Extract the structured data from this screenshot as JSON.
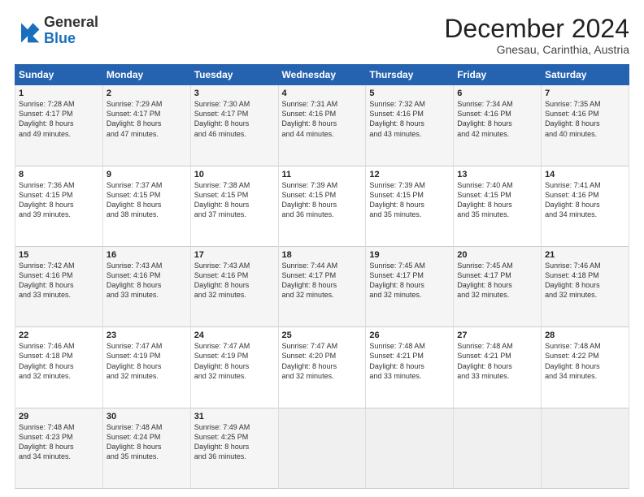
{
  "header": {
    "logo_line1": "General",
    "logo_line2": "Blue",
    "month": "December 2024",
    "location": "Gnesau, Carinthia, Austria"
  },
  "weekdays": [
    "Sunday",
    "Monday",
    "Tuesday",
    "Wednesday",
    "Thursday",
    "Friday",
    "Saturday"
  ],
  "weeks": [
    [
      {
        "day": "1",
        "sunrise": "Sunrise: 7:28 AM",
        "sunset": "Sunset: 4:17 PM",
        "daylight": "Daylight: 8 hours and 49 minutes."
      },
      {
        "day": "2",
        "sunrise": "Sunrise: 7:29 AM",
        "sunset": "Sunset: 4:17 PM",
        "daylight": "Daylight: 8 hours and 47 minutes."
      },
      {
        "day": "3",
        "sunrise": "Sunrise: 7:30 AM",
        "sunset": "Sunset: 4:17 PM",
        "daylight": "Daylight: 8 hours and 46 minutes."
      },
      {
        "day": "4",
        "sunrise": "Sunrise: 7:31 AM",
        "sunset": "Sunset: 4:16 PM",
        "daylight": "Daylight: 8 hours and 44 minutes."
      },
      {
        "day": "5",
        "sunrise": "Sunrise: 7:32 AM",
        "sunset": "Sunset: 4:16 PM",
        "daylight": "Daylight: 8 hours and 43 minutes."
      },
      {
        "day": "6",
        "sunrise": "Sunrise: 7:34 AM",
        "sunset": "Sunset: 4:16 PM",
        "daylight": "Daylight: 8 hours and 42 minutes."
      },
      {
        "day": "7",
        "sunrise": "Sunrise: 7:35 AM",
        "sunset": "Sunset: 4:16 PM",
        "daylight": "Daylight: 8 hours and 40 minutes."
      }
    ],
    [
      {
        "day": "8",
        "sunrise": "Sunrise: 7:36 AM",
        "sunset": "Sunset: 4:15 PM",
        "daylight": "Daylight: 8 hours and 39 minutes."
      },
      {
        "day": "9",
        "sunrise": "Sunrise: 7:37 AM",
        "sunset": "Sunset: 4:15 PM",
        "daylight": "Daylight: 8 hours and 38 minutes."
      },
      {
        "day": "10",
        "sunrise": "Sunrise: 7:38 AM",
        "sunset": "Sunset: 4:15 PM",
        "daylight": "Daylight: 8 hours and 37 minutes."
      },
      {
        "day": "11",
        "sunrise": "Sunrise: 7:39 AM",
        "sunset": "Sunset: 4:15 PM",
        "daylight": "Daylight: 8 hours and 36 minutes."
      },
      {
        "day": "12",
        "sunrise": "Sunrise: 7:39 AM",
        "sunset": "Sunset: 4:15 PM",
        "daylight": "Daylight: 8 hours and 35 minutes."
      },
      {
        "day": "13",
        "sunrise": "Sunrise: 7:40 AM",
        "sunset": "Sunset: 4:15 PM",
        "daylight": "Daylight: 8 hours and 35 minutes."
      },
      {
        "day": "14",
        "sunrise": "Sunrise: 7:41 AM",
        "sunset": "Sunset: 4:16 PM",
        "daylight": "Daylight: 8 hours and 34 minutes."
      }
    ],
    [
      {
        "day": "15",
        "sunrise": "Sunrise: 7:42 AM",
        "sunset": "Sunset: 4:16 PM",
        "daylight": "Daylight: 8 hours and 33 minutes."
      },
      {
        "day": "16",
        "sunrise": "Sunrise: 7:43 AM",
        "sunset": "Sunset: 4:16 PM",
        "daylight": "Daylight: 8 hours and 33 minutes."
      },
      {
        "day": "17",
        "sunrise": "Sunrise: 7:43 AM",
        "sunset": "Sunset: 4:16 PM",
        "daylight": "Daylight: 8 hours and 32 minutes."
      },
      {
        "day": "18",
        "sunrise": "Sunrise: 7:44 AM",
        "sunset": "Sunset: 4:17 PM",
        "daylight": "Daylight: 8 hours and 32 minutes."
      },
      {
        "day": "19",
        "sunrise": "Sunrise: 7:45 AM",
        "sunset": "Sunset: 4:17 PM",
        "daylight": "Daylight: 8 hours and 32 minutes."
      },
      {
        "day": "20",
        "sunrise": "Sunrise: 7:45 AM",
        "sunset": "Sunset: 4:17 PM",
        "daylight": "Daylight: 8 hours and 32 minutes."
      },
      {
        "day": "21",
        "sunrise": "Sunrise: 7:46 AM",
        "sunset": "Sunset: 4:18 PM",
        "daylight": "Daylight: 8 hours and 32 minutes."
      }
    ],
    [
      {
        "day": "22",
        "sunrise": "Sunrise: 7:46 AM",
        "sunset": "Sunset: 4:18 PM",
        "daylight": "Daylight: 8 hours and 32 minutes."
      },
      {
        "day": "23",
        "sunrise": "Sunrise: 7:47 AM",
        "sunset": "Sunset: 4:19 PM",
        "daylight": "Daylight: 8 hours and 32 minutes."
      },
      {
        "day": "24",
        "sunrise": "Sunrise: 7:47 AM",
        "sunset": "Sunset: 4:19 PM",
        "daylight": "Daylight: 8 hours and 32 minutes."
      },
      {
        "day": "25",
        "sunrise": "Sunrise: 7:47 AM",
        "sunset": "Sunset: 4:20 PM",
        "daylight": "Daylight: 8 hours and 32 minutes."
      },
      {
        "day": "26",
        "sunrise": "Sunrise: 7:48 AM",
        "sunset": "Sunset: 4:21 PM",
        "daylight": "Daylight: 8 hours and 33 minutes."
      },
      {
        "day": "27",
        "sunrise": "Sunrise: 7:48 AM",
        "sunset": "Sunset: 4:21 PM",
        "daylight": "Daylight: 8 hours and 33 minutes."
      },
      {
        "day": "28",
        "sunrise": "Sunrise: 7:48 AM",
        "sunset": "Sunset: 4:22 PM",
        "daylight": "Daylight: 8 hours and 34 minutes."
      }
    ],
    [
      {
        "day": "29",
        "sunrise": "Sunrise: 7:48 AM",
        "sunset": "Sunset: 4:23 PM",
        "daylight": "Daylight: 8 hours and 34 minutes."
      },
      {
        "day": "30",
        "sunrise": "Sunrise: 7:48 AM",
        "sunset": "Sunset: 4:24 PM",
        "daylight": "Daylight: 8 hours and 35 minutes."
      },
      {
        "day": "31",
        "sunrise": "Sunrise: 7:49 AM",
        "sunset": "Sunset: 4:25 PM",
        "daylight": "Daylight: 8 hours and 36 minutes."
      },
      null,
      null,
      null,
      null
    ]
  ]
}
